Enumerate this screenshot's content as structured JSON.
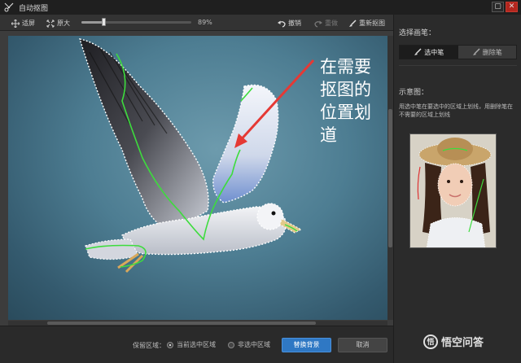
{
  "window": {
    "title": "自动抠图",
    "minimize": "▢",
    "close": "✕"
  },
  "toolbar": {
    "fit_label": "适屏",
    "original_label": "原大",
    "zoom_fraction": 0.2,
    "zoom_text": "89%",
    "undo_label": "撤销",
    "redo_label": "重做",
    "redo_enabled": false,
    "reset_label": "重新抠图"
  },
  "canvas": {
    "annotation_text": "在需要抠图的位置划道",
    "annotation_color": "#ffffff",
    "arrow_color": "#e53935",
    "stroke_color": "#3ddc3d"
  },
  "bottom": {
    "keep_label": "保留区域：",
    "option_current": "当前选中区域",
    "option_noncurrent": "非选中区域",
    "selected_option": "option_current",
    "replace_button": "替换背景",
    "cancel_button": "取消"
  },
  "right_panel": {
    "brush_title": "选择画笔：",
    "brush_select": "选中笔",
    "brush_delete": "删除笔",
    "active_brush": "brush_select",
    "sample_title": "示意图：",
    "hint_text": "用选中笔在要选中的区域上划线，用删除笔在不需要的区域上划线"
  },
  "watermark": {
    "text": "悟空问答",
    "logo": "悟"
  },
  "colors": {
    "accent": "#2f78c4",
    "panel": "#2b2b2b",
    "close": "#b3261e"
  }
}
